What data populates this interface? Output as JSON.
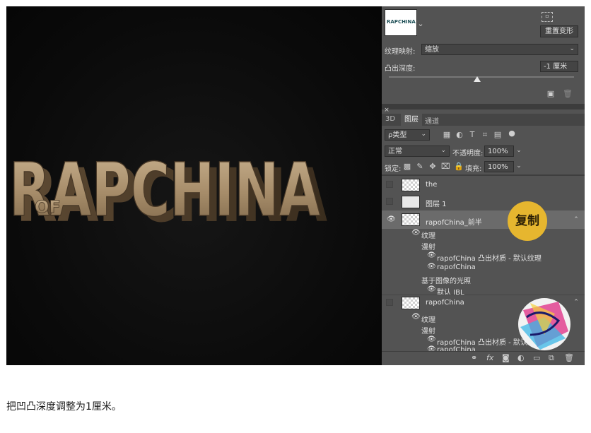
{
  "canvas": {
    "artwork_text": "RAPCHINA",
    "artwork_small_text": "OF"
  },
  "properties_panel": {
    "material_thumb_text": "RAPCHINA",
    "reset_transform_button": "重置变形",
    "texture_mapping_label": "纹理映射:",
    "texture_mapping_value": "缩放",
    "extrusion_depth_label": "凸出深度:",
    "extrusion_depth_value": "-1 厘米"
  },
  "layers_panel": {
    "tabs": [
      "3D",
      "图层",
      "通道"
    ],
    "filter_label": "ρ类型",
    "blend_mode": "正常",
    "opacity_label": "不透明度:",
    "opacity_value": "100%",
    "lock_label": "锁定:",
    "fill_label": "填充:",
    "fill_value": "100%",
    "layers": [
      {
        "name": "the"
      },
      {
        "name": "图层 1"
      },
      {
        "name": "rapofChina_前半"
      },
      {
        "name": "rapofChina"
      }
    ],
    "group1": {
      "texture": "纹理",
      "diffuse": "漫射",
      "item1": "rapofChina 凸出材质 - 默认纹理",
      "item2": "rapofChina",
      "ibl_header": "基于图像的光照",
      "ibl_item": "默认 IBL"
    },
    "group2": {
      "texture": "纹理",
      "diffuse": "漫射",
      "item1": "rapofChina 凸出材质 - 默认纹理",
      "item2": "rapofChina"
    }
  },
  "annotation_bubble": "复制",
  "caption": "把凹凸深度调整为1厘米。",
  "colors": {
    "panel_bg": "#535353",
    "selected_row": "#6b6b6b",
    "bubble": "#e6b62f",
    "artwork_gold": "#b39a7a"
  }
}
